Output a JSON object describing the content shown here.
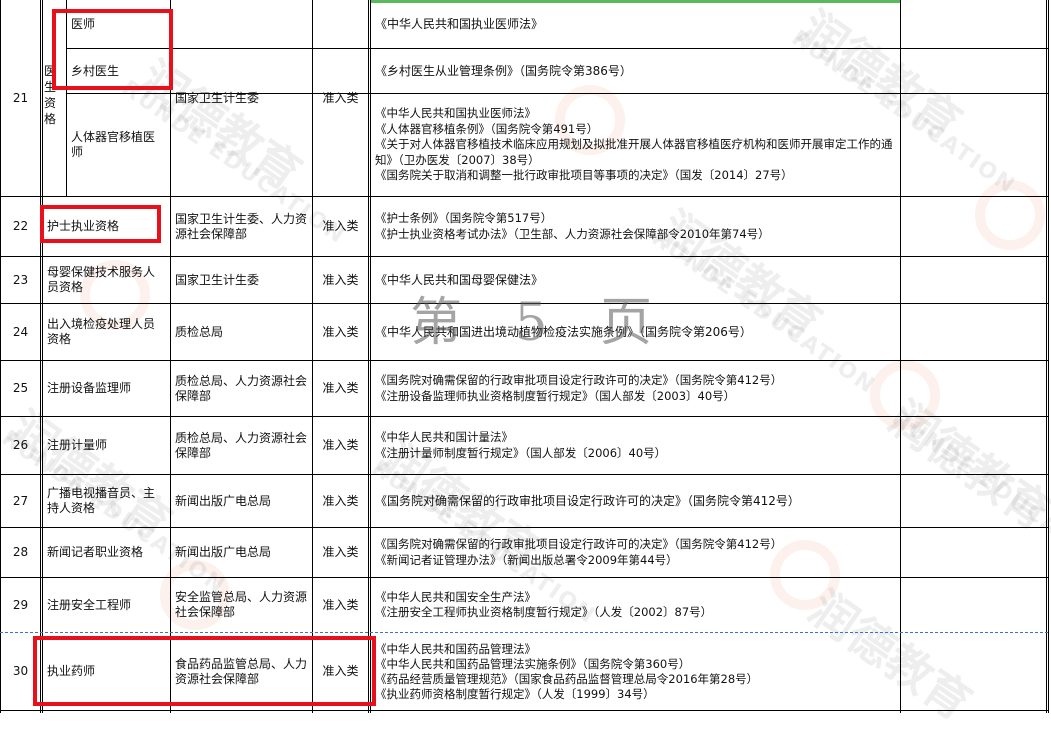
{
  "watermark": {
    "page_label": "第 5 页",
    "brand_cn": "润德教育",
    "brand_en": "RUNDE EDUCATION"
  },
  "rows": [
    {
      "id": "21",
      "qualification": "医生资格",
      "sub": [
        {
          "name": "医师",
          "laws": [
            "《中华人民共和国执业医师法》"
          ]
        },
        {
          "name": "乡村医生",
          "laws": [
            "《乡村医生从业管理条例》（国务院令第386号）"
          ]
        },
        {
          "name": "人体器官移植医师",
          "laws": [
            "《中华人民共和国执业医师法》",
            "《人体器官移植条例》（国务院令第491号）",
            "《关于对人体器官移植技术临床应用规划及拟批准开展人体器官移植医疗机构和医师开展审定工作的通知》（卫办医发〔2007〕38号）",
            "《国务院关于取消和调整一批行政审批项目等事项的决定》（国发〔2014〕27号）"
          ]
        }
      ],
      "dept": "国家卫生计生委",
      "type": "准入类"
    },
    {
      "id": "22",
      "qualification": "护士执业资格",
      "dept": "国家卫生计生委、人力资源社会保障部",
      "type": "准入类",
      "laws": [
        "《护士条例》（国务院令第517号）",
        "《护士执业资格考试办法》（卫生部、人力资源社会保障部令2010年第74号）"
      ]
    },
    {
      "id": "23",
      "qualification": "母婴保健技术服务人员资格",
      "dept": "国家卫生计生委",
      "type": "准入类",
      "laws": [
        "《中华人民共和国母婴保健法》"
      ]
    },
    {
      "id": "24",
      "qualification": "出入境检疫处理人员资格",
      "dept": "质检总局",
      "type": "准入类",
      "laws": [
        "《中华人民共和国进出境动植物检疫法实施条例》（国务院令第206号）"
      ]
    },
    {
      "id": "25",
      "qualification": "注册设备监理师",
      "dept": "质检总局、人力资源社会保障部",
      "type": "准入类",
      "laws": [
        "《国务院对确需保留的行政审批项目设定行政许可的决定》（国务院令第412号）",
        "《注册设备监理师执业资格制度暂行规定》（国人部发〔2003〕40号）"
      ]
    },
    {
      "id": "26",
      "qualification": "注册计量师",
      "dept": "质检总局、人力资源社会保障部",
      "type": "准入类",
      "laws": [
        "《中华人民共和国计量法》",
        "《注册计量师制度暂行规定》（国人部发〔2006〕40号）"
      ]
    },
    {
      "id": "27",
      "qualification": "广播电视播音员、主持人资格",
      "dept": "新闻出版广电总局",
      "type": "准入类",
      "laws": [
        "《国务院对确需保留的行政审批项目设定行政许可的决定》（国务院令第412号）"
      ]
    },
    {
      "id": "28",
      "qualification": "新闻记者职业资格",
      "dept": "新闻出版广电总局",
      "type": "准入类",
      "laws": [
        "《国务院对确需保留的行政审批项目设定行政许可的决定》（国务院令第412号）",
        "《新闻记者证管理办法》（新闻出版总署令2009年第44号）"
      ]
    },
    {
      "id": "29",
      "qualification": "注册安全工程师",
      "dept": "安全监管总局、人力资源社会保障部",
      "type": "准入类",
      "laws": [
        "《中华人民共和国安全生产法》",
        "《注册安全工程师执业资格制度暂行规定》（人发〔2002〕87号）"
      ]
    },
    {
      "id": "30",
      "qualification": "执业药师",
      "dept": "食品药品监管总局、人力资源社会保障部",
      "type": "准入类",
      "laws": [
        "《中华人民共和国药品管理法》",
        "《中华人民共和国药品管理法实施条例》（国务院令第360号）",
        "《药品经营质量管理规范》（国家食品药品监督管理总局令2016年第28号）",
        "《执业药师资格制度暂行规定》（人发〔1999〕34号）"
      ]
    }
  ],
  "colors": {
    "grid": "#000000",
    "highlight": "#e8101a",
    "top_border": "#5cb85c"
  }
}
